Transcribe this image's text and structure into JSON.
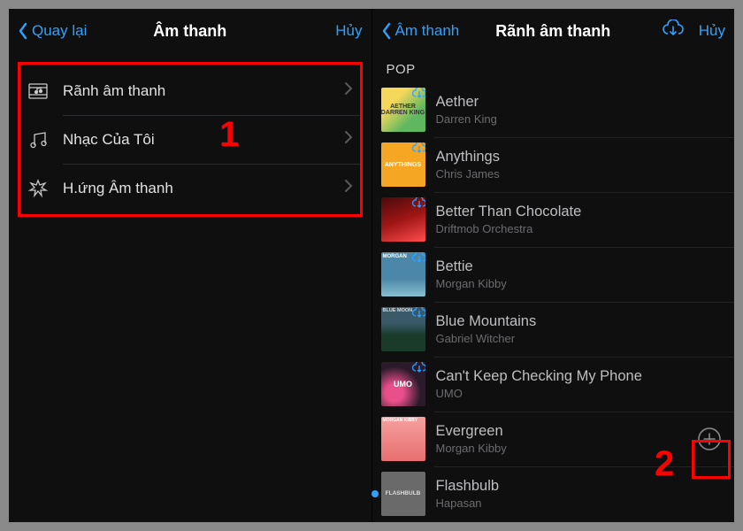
{
  "left": {
    "nav": {
      "back": "Quay lại",
      "title": "Âm thanh",
      "cancel": "Hủy"
    },
    "menu": [
      {
        "label": "Rãnh âm thanh"
      },
      {
        "label": "Nhạc Của Tôi"
      },
      {
        "label": "H.ứng Âm thanh"
      }
    ],
    "callout": "1"
  },
  "right": {
    "nav": {
      "back": "Âm thanh",
      "title": "Rãnh âm thanh",
      "cancel": "Hủy"
    },
    "section": "POP",
    "tracks": [
      {
        "title": "Aether",
        "artist": "Darren King",
        "cloud": true
      },
      {
        "title": "Anythings",
        "artist": "Chris James",
        "cloud": true
      },
      {
        "title": "Better Than Chocolate",
        "artist": "Driftmob Orchestra",
        "cloud": true
      },
      {
        "title": "Bettie",
        "artist": "Morgan Kibby",
        "cloud": true
      },
      {
        "title": "Blue Mountains",
        "artist": "Gabriel Witcher",
        "cloud": true
      },
      {
        "title": "Can't Keep Checking My Phone",
        "artist": "UMO",
        "cloud": true
      },
      {
        "title": "Evergreen",
        "artist": "Morgan Kibby",
        "cloud": false,
        "add": true
      },
      {
        "title": "Flashbulb",
        "artist": "Hapasan",
        "cloud": false,
        "playing": true
      }
    ],
    "callout": "2"
  },
  "colors": {
    "accent": "#2da2ff",
    "highlight": "#ff0000"
  }
}
